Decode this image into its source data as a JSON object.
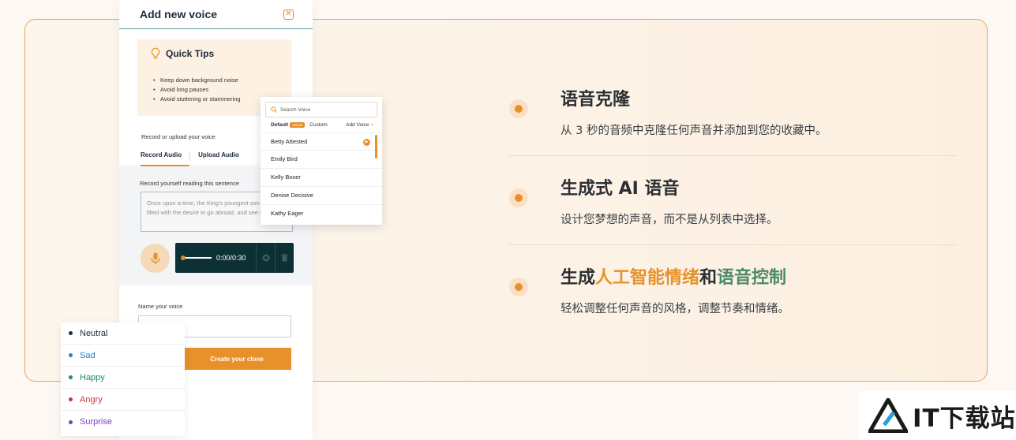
{
  "panel": {
    "title": "Add new voice",
    "tips_title": "Quick Tips",
    "tips": [
      "Keep down background noise",
      "Avoid long pauses",
      "Avoid stuttering or stammering"
    ],
    "record_label": "Record or upload your voice",
    "tabs": [
      "Record Audio",
      "Upload Audio"
    ],
    "read_label": "Record yourself reading this sentence",
    "sentence": "Once upon a time, the King's youngest son became filled with the desire to go abroad, and see the world.",
    "time": "0:00/0:30",
    "name_label": "Name your voice",
    "name_value": "",
    "create_label": "Create your clone"
  },
  "dropdown": {
    "search_placeholder": "Search Voice",
    "tab_default": "Default",
    "badge": "Voices",
    "tab_custom": "Custom",
    "add_voice": "Add Voice",
    "add_icon": "+",
    "voices": [
      "Betty Attested",
      "Emily Bird",
      "Kelly Boxer",
      "Denise Decisive",
      "Kathy Eager"
    ]
  },
  "emotions": [
    {
      "label": "Neutral",
      "color": "#1e2b3a"
    },
    {
      "label": "Sad",
      "color": "#2a7dbf"
    },
    {
      "label": "Happy",
      "color": "#1f8a70"
    },
    {
      "label": "Angry",
      "color": "#d0343b"
    },
    {
      "label": "Surprise",
      "color": "#7a3fc4"
    }
  ],
  "features": [
    {
      "title": "语音克隆",
      "desc": "从 3 秒的音频中克隆任何声音并添加到您的收藏中。"
    },
    {
      "title": "生成式 AI 语音",
      "desc": "设计您梦想的声音，而不是从列表中选择。"
    },
    {
      "title_parts": [
        "生成",
        "人工智能情绪",
        "和",
        "语音控制"
      ],
      "desc": "轻松调整任何声音的风格，调整节奏和情绪。"
    }
  ],
  "colors": {
    "accent": "#e8912a",
    "green": "#4a8a6a",
    "dark_teal": "#0d3036"
  },
  "watermark": {
    "text": "IT下载站"
  }
}
